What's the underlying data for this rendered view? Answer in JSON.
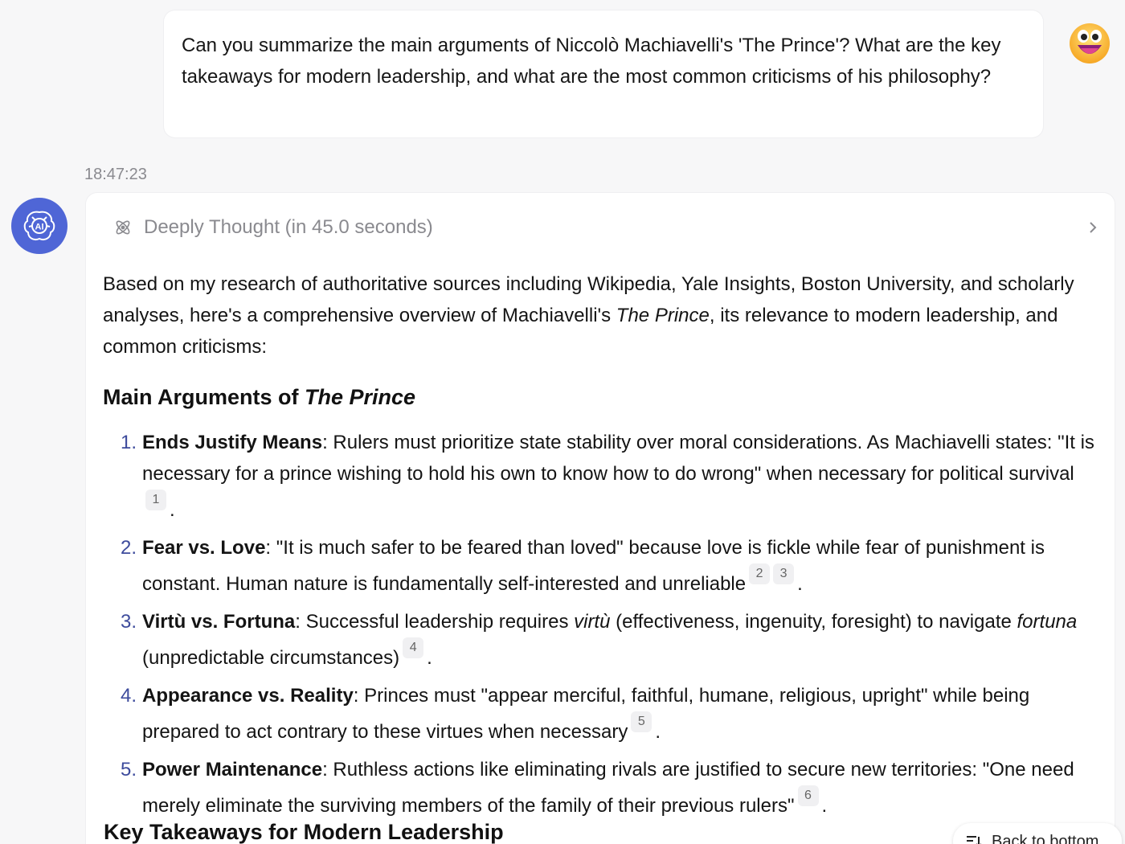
{
  "user": {
    "message": "Can you summarize the main arguments of Niccolò Machiavelli's 'The Prince'? What are the key takeaways for modern leadership, and what are the most common criticisms of his philosophy?"
  },
  "timestamp": "18:47:23",
  "ai": {
    "avatar_label": "AI",
    "thought_label": "Deeply Thought (in 45.0 seconds)",
    "intro_a": "Based on my research of authoritative sources including Wikipedia, Yale Insights, Boston University, and scholarly analyses, here's a comprehensive overview of Machiavelli's ",
    "intro_em": "The Prince",
    "intro_b": ", its relevance to modern leadership, and common criticisms:",
    "section1_a": "Main Arguments of ",
    "section1_em": "The Prince",
    "arguments": [
      {
        "num": "1.",
        "title": "Ends Justify Means",
        "text": ": Rulers must prioritize state stability over moral considerations. As Machiavelli states: \"It is necessary for a prince wishing to hold his own to know how to do wrong\" when necessary for political survival",
        "cites": [
          "1"
        ]
      },
      {
        "num": "2.",
        "title": "Fear vs. Love",
        "text": ": \"It is much safer to be feared than loved\" because love is fickle while fear of punishment is constant. Human nature is fundamentally self-interested and unreliable",
        "cites": [
          "2",
          "3"
        ]
      },
      {
        "num": "3.",
        "title": "Virtù vs. Fortuna",
        "text_a": ": Successful leadership requires ",
        "em_a": "virtù",
        "text_b": " (effectiveness, ingenuity, foresight) to navigate ",
        "em_b": "fortuna",
        "text_c": " (unpredictable circumstances)",
        "cites": [
          "4"
        ]
      },
      {
        "num": "4.",
        "title": "Appearance vs. Reality",
        "text": ": Princes must \"appear merciful, faithful, humane, religious, upright\" while being prepared to act contrary to these virtues when necessary",
        "cites": [
          "5"
        ]
      },
      {
        "num": "5.",
        "title": "Power Maintenance",
        "text": ": Ruthless actions like eliminating rivals are justified to secure new territories: \"One need merely eliminate the surviving members of the family of their previous rulers\"",
        "cites": [
          "6"
        ]
      }
    ],
    "section2": "Key Takeaways for Modern Leadership"
  },
  "back_to_bottom": "Back to bottom",
  "colors": {
    "ai_avatar_bg": "#4f66d6",
    "list_number": "#3d4b9c"
  }
}
